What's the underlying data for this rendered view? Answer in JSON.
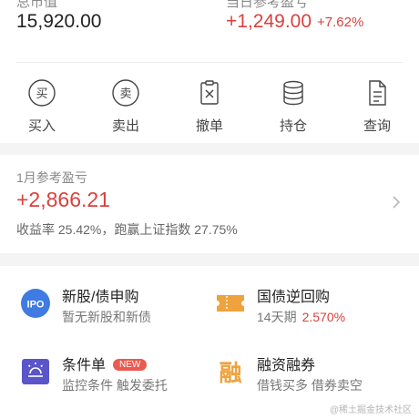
{
  "summary": {
    "total_label": "总市值",
    "total_value": "15,920.00",
    "today_label": "当日参考盈亏",
    "today_value": "+1,249.00",
    "today_pct": "+7.62%"
  },
  "actions": [
    {
      "label": "买入",
      "icon": "buy-icon",
      "glyph": "买"
    },
    {
      "label": "卖出",
      "icon": "sell-icon",
      "glyph": "卖"
    },
    {
      "label": "撤单",
      "icon": "cancel-order-icon"
    },
    {
      "label": "持仓",
      "icon": "holdings-icon"
    },
    {
      "label": "查询",
      "icon": "query-icon"
    }
  ],
  "monthly": {
    "label": "1月参考盈亏",
    "value": "+2,866.21",
    "detail": "收益率 25.42%，跑赢上证指数 27.75%"
  },
  "services": {
    "ipo": {
      "title": "新股/债申购",
      "desc": "暂无新股和新债",
      "icon": "ipo-icon",
      "icon_text": "IPO"
    },
    "repo": {
      "title": "国债逆回购",
      "desc_term": "14天期",
      "desc_rate": "2.570%",
      "icon": "ticket-icon"
    },
    "conditional": {
      "title": "条件单",
      "badge": "NEW",
      "desc": "监控条件 触发委托",
      "icon": "bulb-icon"
    },
    "margin": {
      "title": "融资融券",
      "desc": "借钱买多 借券卖空",
      "icon": "margin-icon",
      "icon_text": "融"
    }
  },
  "watermark": "@稀土掘金技术社区",
  "colors": {
    "red": "#d9413e",
    "ipo_blue": "#3f7be0",
    "orange": "#f0a23c",
    "purple": "#5a55c9"
  }
}
